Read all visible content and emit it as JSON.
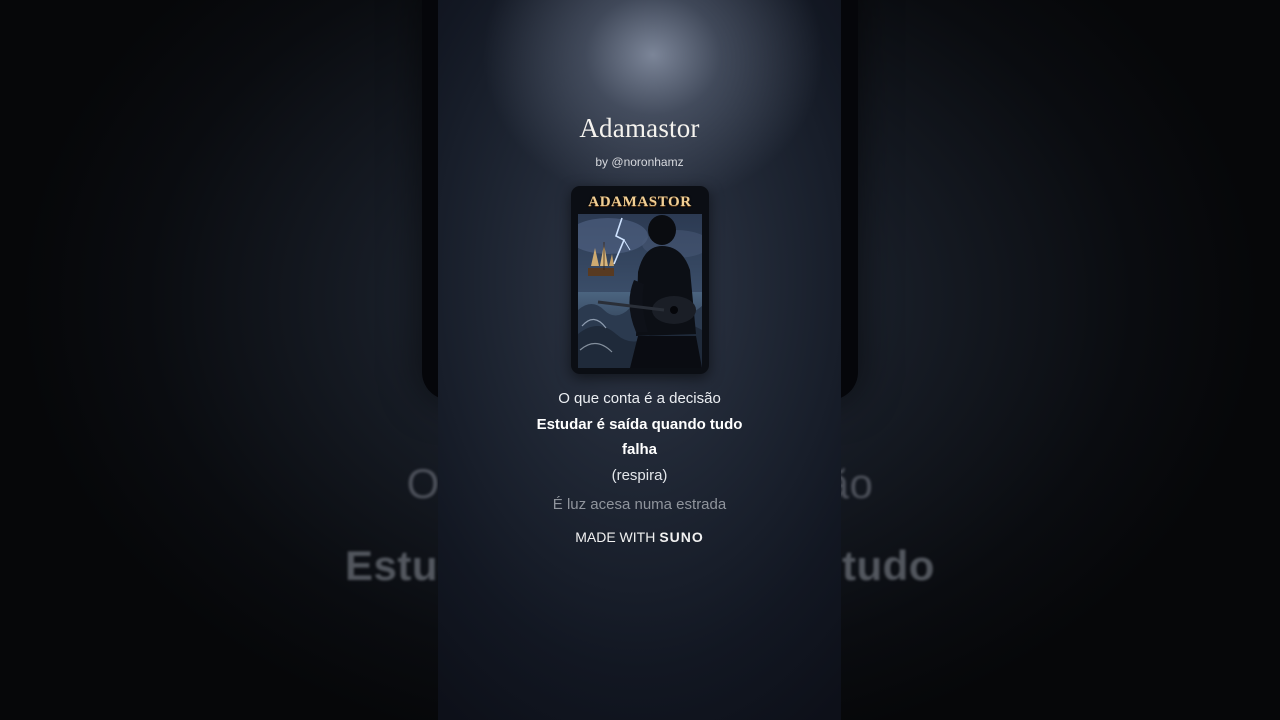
{
  "background": {
    "lyric_line_1": "O que conta é a decisão",
    "lyric_line_2": "Estudar é saída quando tudo"
  },
  "song": {
    "title": "Adamastor",
    "byline": "by @noronhamz",
    "cover_title": "ADAMASTOR"
  },
  "lyrics": [
    "O que conta é a decisão",
    "Estudar é saída quando tudo",
    "falha",
    "(respira)",
    "É luz acesa numa estrada"
  ],
  "footer": {
    "made_with": "MADE WITH",
    "brand": "SUNO"
  },
  "colors": {
    "title": "#f4f2ee",
    "cover_title": "#f0cf95",
    "faded_lyric": "#8f949c"
  },
  "icons": {
    "cover_art": "guitarist-silhouette-storm-ship"
  }
}
